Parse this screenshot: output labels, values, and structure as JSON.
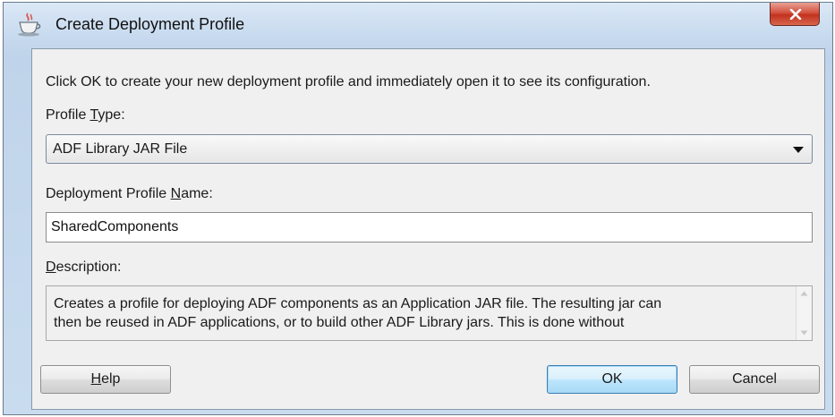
{
  "window": {
    "title": "Create Deployment Profile",
    "icon": "java-cup-icon",
    "close_icon": "close-icon"
  },
  "instruction": "Click OK to create your new deployment profile and immediately open it to see its configuration.",
  "profile_type": {
    "label_before": "Profile ",
    "label_mnemonic": "T",
    "label_after": "ype:",
    "selected": "ADF Library JAR File"
  },
  "profile_name": {
    "label_before": "Deployment Profile ",
    "label_mnemonic": "N",
    "label_after": "ame:",
    "value": "SharedComponents"
  },
  "description": {
    "label_before": "",
    "label_mnemonic": "D",
    "label_after": "escription:",
    "lines": [
      "Creates a profile for deploying ADF components as an Application JAR file. The resulting jar can",
      "then be reused in ADF applications, or to build other ADF Library jars. This is done without"
    ]
  },
  "buttons": {
    "help_mnemonic": "H",
    "help_rest": "elp",
    "ok": "OK",
    "cancel": "Cancel"
  },
  "colors": {
    "title_bar": "#c6d9ee",
    "close_button": "#c2321e",
    "default_button_border": "#3c7fb1"
  }
}
